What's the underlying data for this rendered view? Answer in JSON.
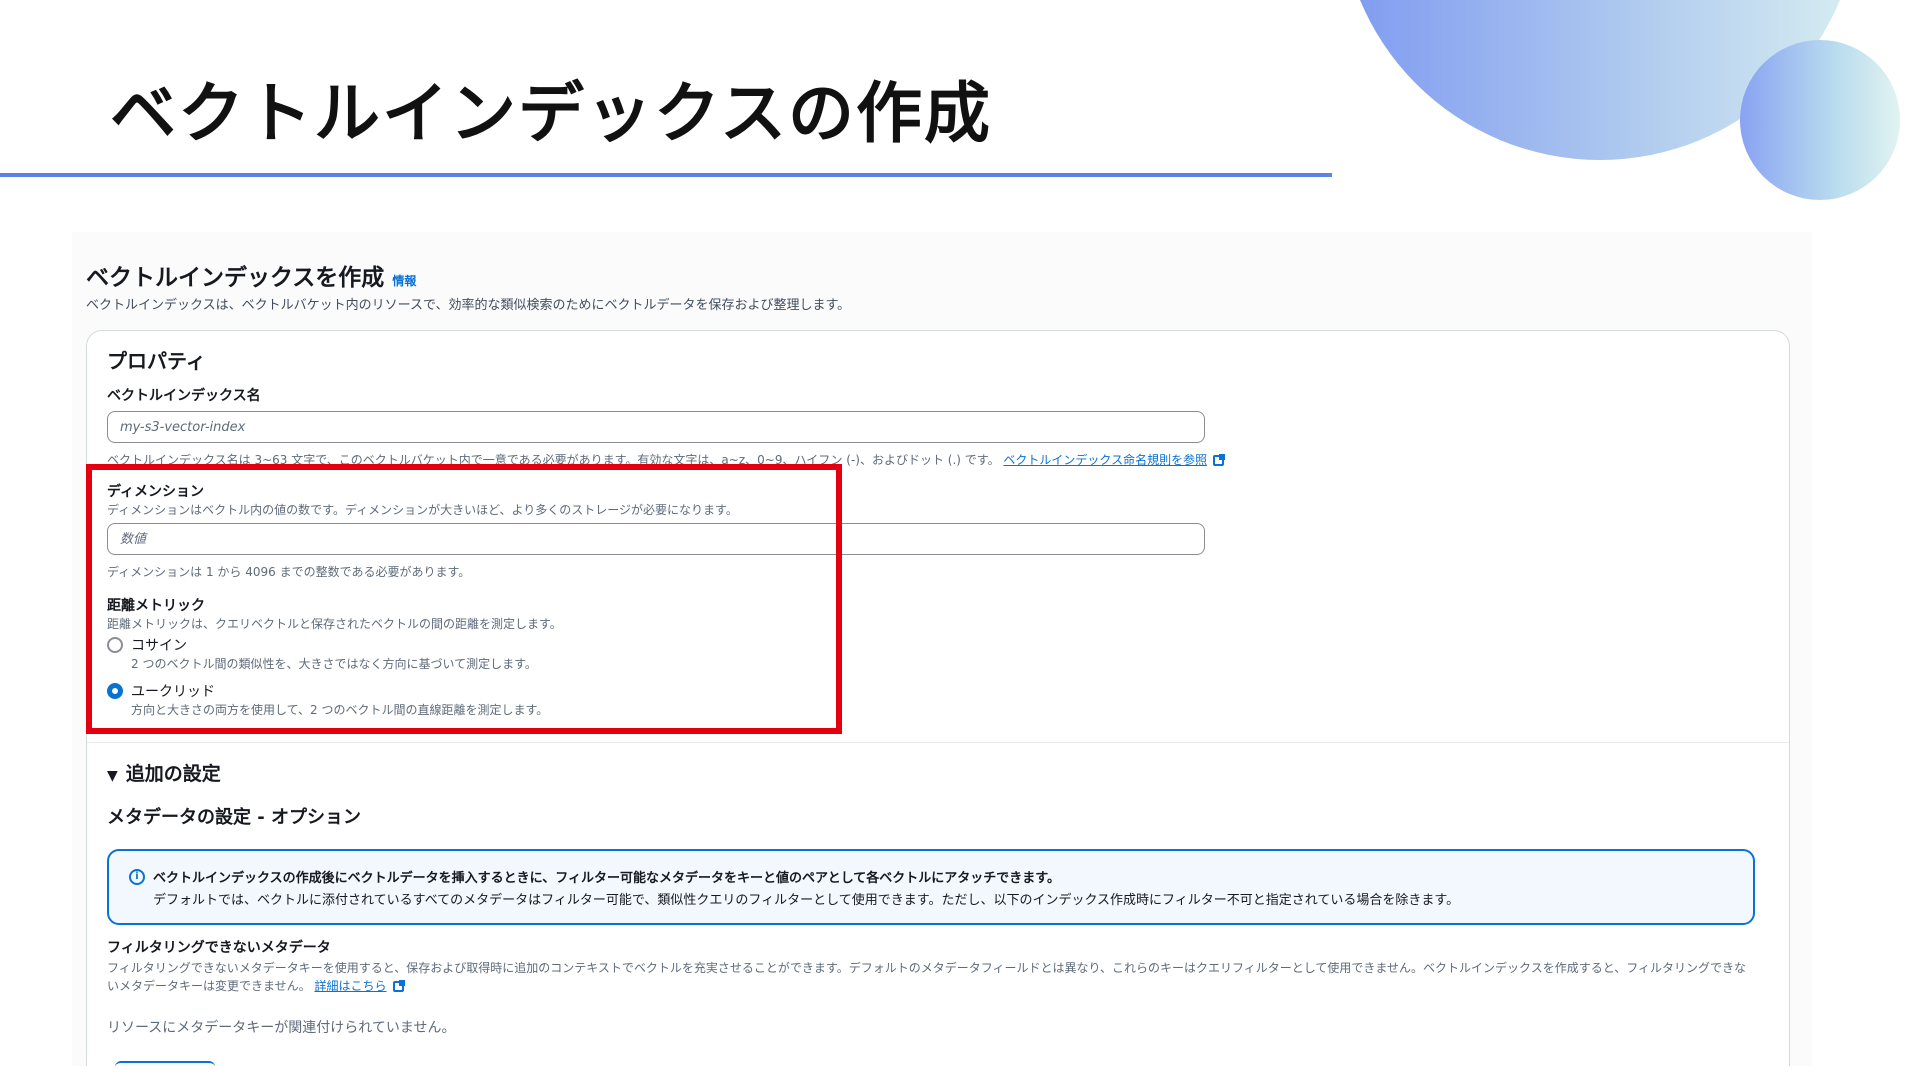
{
  "slide": {
    "title": "ベクトルインデックスの作成"
  },
  "page": {
    "title": "ベクトルインデックスを作成",
    "info_link": "情報",
    "description": "ベクトルインデックスは、ベクトルバケット内のリソースで、効率的な類似検索のためにベクトルデータを保存および整理します。"
  },
  "properties": {
    "title": "プロパティ",
    "index_name": {
      "label": "ベクトルインデックス名",
      "placeholder": "my-s3-vector-index",
      "constraint": "ベクトルインデックス名は 3~63 文字で、このベクトルバケット内で一意である必要があります。有効な文字は、a~z、0~9、ハイフン (-)、およびドット (.) です。",
      "link": "ベクトルインデックス命名規則を参照"
    },
    "dimension": {
      "label": "ディメンション",
      "description": "ディメンションはベクトル内の値の数です。ディメンションが大きいほど、より多くのストレージが必要になります。",
      "placeholder": "数値",
      "constraint": "ディメンションは 1 から 4096 までの整数である必要があります。"
    },
    "distance_metric": {
      "label": "距離メトリック",
      "description": "距離メトリックは、クエリベクトルと保存されたベクトルの間の距離を測定します。",
      "options": [
        {
          "label": "コサイン",
          "description": "2 つのベクトル間の類似性を、大きさではなく方向に基づいて測定します。",
          "selected": false
        },
        {
          "label": "ユークリッド",
          "description": "方向と大きさの両方を使用して、2 つのベクトル間の直線距離を測定します。",
          "selected": true
        }
      ]
    }
  },
  "additional": {
    "expander_label": "追加の設定",
    "metadata_title": "メタデータの設定 - オプション",
    "info_head": "ベクトルインデックスの作成後にベクトルデータを挿入するときに、フィルター可能なメタデータをキーと値のペアとして各ベクトルにアタッチできます。",
    "info_body": "デフォルトでは、ベクトルに添付されているすべてのメタデータはフィルター可能で、類似性クエリのフィルターとして使用できます。ただし、以下のインデックス作成時にフィルター不可と指定されている場合を除きます。",
    "non_filterable_label": "フィルタリングできないメタデータ",
    "non_filterable_desc": "フィルタリングできないメタデータキーを使用すると、保存および取得時に追加のコンテキストでベクトルを充実させることができます。デフォルトのメタデータフィールドとは異なり、これらのキーはクエリフィルターとして使用できません。ベクトルインデックスを作成すると、フィルタリングできないメタデータキーは変更できません。",
    "details_link": "詳細はこちら",
    "empty_note": "リソースにメタデータキーが関連付けられていません。"
  },
  "colors": {
    "accent": "#0972d3",
    "highlight": "#e4000f",
    "title_rule": "#5b82e8"
  }
}
